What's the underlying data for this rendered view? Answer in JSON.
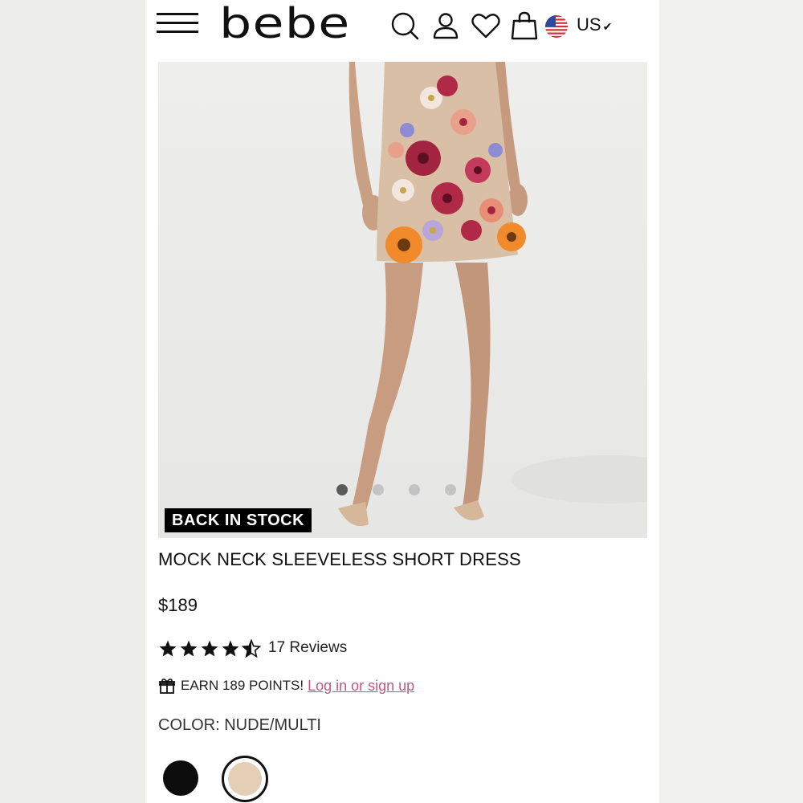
{
  "brand": {
    "logo_text": "bebe"
  },
  "header": {
    "country_label": "US",
    "icons": [
      "menu-icon",
      "search-icon",
      "account-icon",
      "wishlist-heart-icon",
      "shopping-bag-icon",
      "us-flag-icon",
      "chevron-down-icon"
    ]
  },
  "gallery": {
    "badge": "BACK IN STOCK",
    "slide_count": 4,
    "active_slide": 1
  },
  "product": {
    "title": "MOCK NECK SLEEVELESS SHORT DRESS",
    "price": "$189",
    "rating": 4.5,
    "reviews_label": "17 Reviews",
    "points_text": "EARN 189 POINTS!",
    "login_link": "Log in or sign up",
    "color_label": "COLOR: NUDE/MULTI"
  },
  "swatches": [
    {
      "name": "Black",
      "color": "#0c0c0c",
      "selected": false
    },
    {
      "name": "Nude/Multi",
      "color": "#e4cfb6",
      "selected": true
    }
  ],
  "colors": {
    "link": "#c05a7c",
    "badge_bg": "#000000",
    "text": "#111111"
  }
}
